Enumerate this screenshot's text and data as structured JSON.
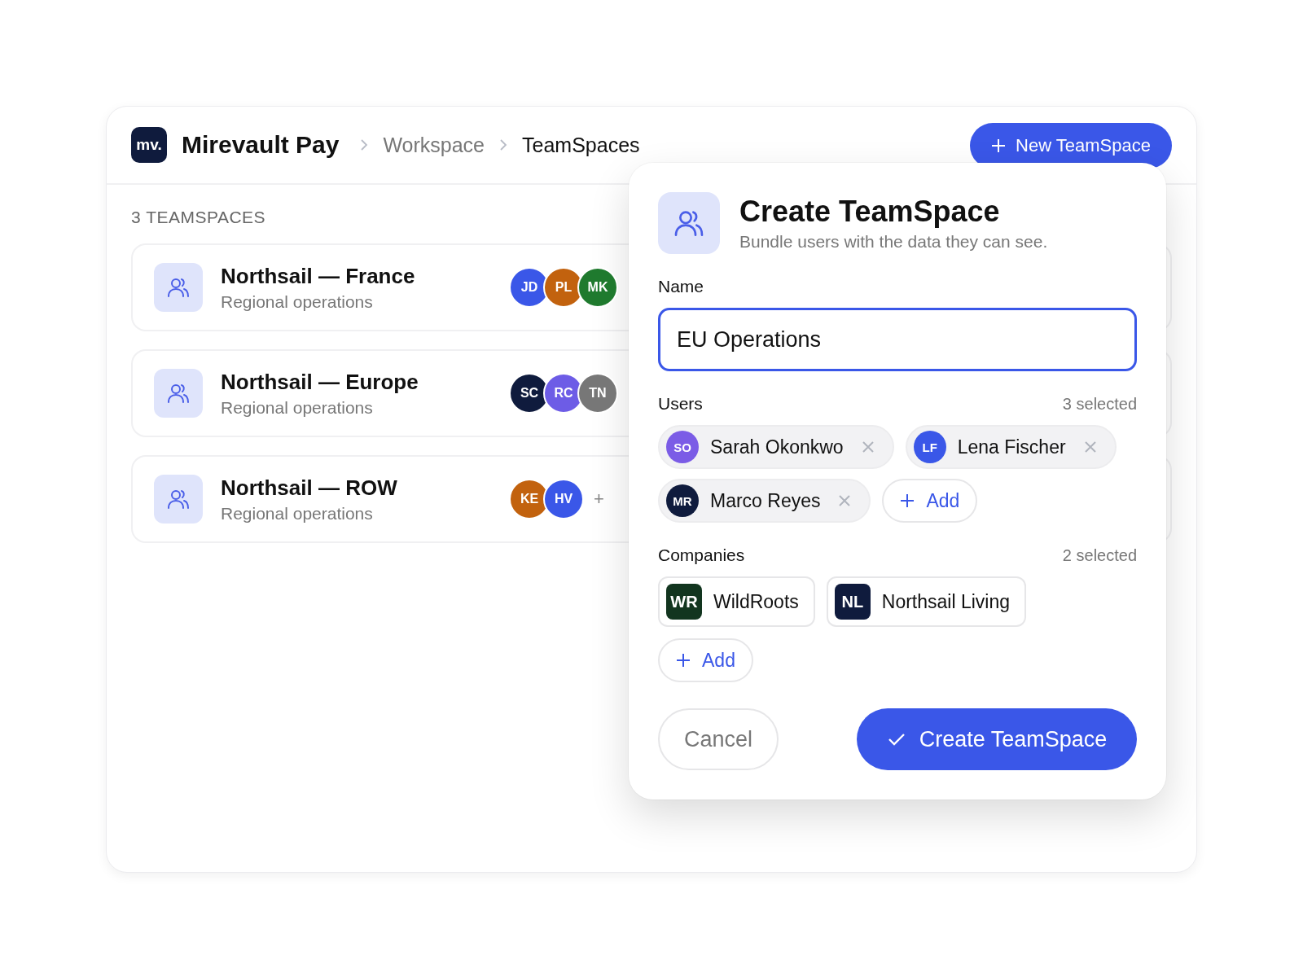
{
  "app": {
    "logo": "mv.",
    "name": "Mirevault Pay"
  },
  "breadcrumbs": [
    {
      "label": "Workspace",
      "current": false
    },
    {
      "label": "TeamSpaces",
      "current": true
    }
  ],
  "new_button": {
    "label": "New TeamSpace"
  },
  "list": {
    "count_label": "3 TEAMSPACES",
    "items": [
      {
        "title": "Northsail — France",
        "subtitle": "Regional operations",
        "members": [
          {
            "initials": "JD",
            "color": "#3a57e8"
          },
          {
            "initials": "PL",
            "color": "#c2620e"
          },
          {
            "initials": "MK",
            "color": "#1f7a2e"
          }
        ]
      },
      {
        "title": "Northsail — Europe",
        "subtitle": "Regional operations",
        "members": [
          {
            "initials": "SC",
            "color": "#0f1b3d"
          },
          {
            "initials": "RC",
            "color": "#6d5ce6"
          },
          {
            "initials": "TN",
            "color": "#777777"
          }
        ]
      },
      {
        "title": "Northsail — ROW",
        "subtitle": "Regional operations",
        "members": [
          {
            "initials": "KE",
            "color": "#c2620e"
          },
          {
            "initials": "HV",
            "color": "#3a57e8"
          }
        ],
        "more": "+"
      }
    ]
  },
  "dialog": {
    "title": "Create TeamSpace",
    "subtitle": "Bundle users with the data they can see.",
    "name_label": "Name",
    "name_value": "EU Operations",
    "users_label": "Users",
    "users_count": "3 selected",
    "users": [
      {
        "initials": "SO",
        "name": "Sarah Okonkwo",
        "color": "#7b5ce6"
      },
      {
        "initials": "LF",
        "name": "Lena Fischer",
        "color": "#3a57e8"
      },
      {
        "initials": "MR",
        "name": "Marco Reyes",
        "color": "#0f1b3d"
      }
    ],
    "add_user": "Add",
    "companies_label": "Companies",
    "companies_count": "2 selected",
    "companies": [
      {
        "initials": "WR",
        "name": "WildRoots",
        "color": "#12351f"
      },
      {
        "initials": "NL",
        "name": "Northsail Living",
        "color": "#0f1b3d"
      }
    ],
    "add_company": "Add",
    "cancel": "Cancel",
    "submit": "Create TeamSpace"
  }
}
